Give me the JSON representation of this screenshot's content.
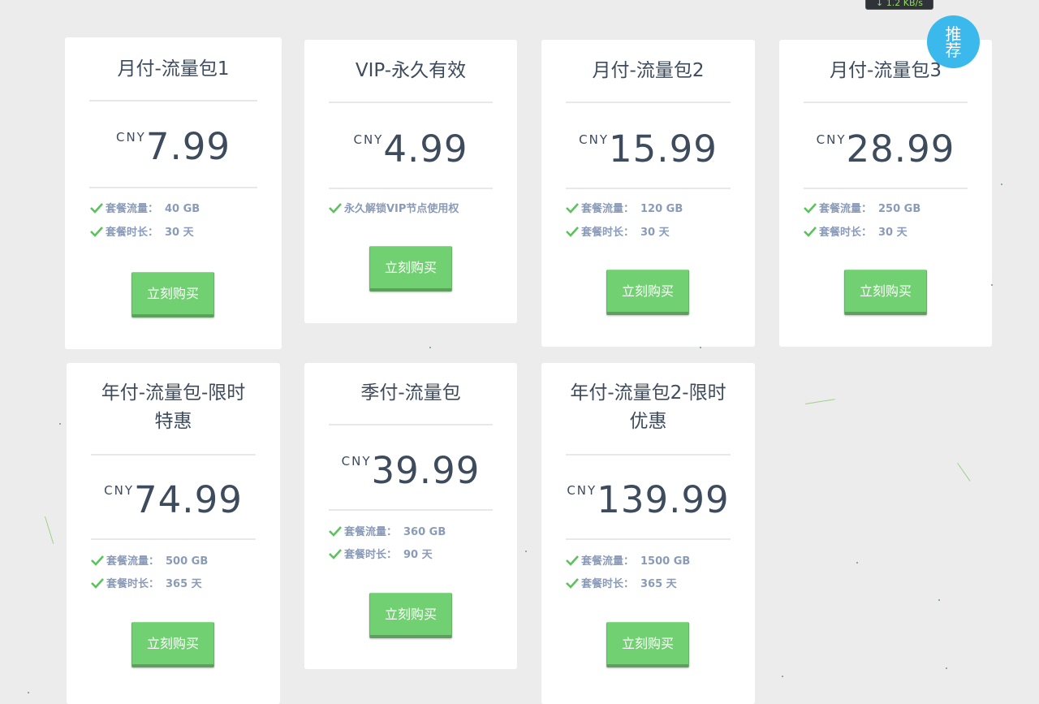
{
  "speed_indicator": "↓ 1.2 KB/s",
  "badge": {
    "line1": "推",
    "line2": "荐"
  },
  "buy_label": "立刻购买",
  "currency": "CNY",
  "plans": [
    {
      "title": "月付-流量包1",
      "price": "7.99",
      "features": [
        {
          "label": "套餐流量：",
          "value": "40 GB"
        },
        {
          "label": "套餐时长：",
          "value": "30 天"
        }
      ]
    },
    {
      "title": "VIP-永久有效",
      "price": "4.99",
      "features": [
        {
          "label": "永久解锁VIP节点使用权",
          "value": ""
        }
      ]
    },
    {
      "title": "月付-流量包2",
      "price": "15.99",
      "features": [
        {
          "label": "套餐流量：",
          "value": "120 GB"
        },
        {
          "label": "套餐时长：",
          "value": "30 天"
        }
      ]
    },
    {
      "title": "月付-流量包3",
      "price": "28.99",
      "features": [
        {
          "label": "套餐流量：",
          "value": "250 GB"
        },
        {
          "label": "套餐时长：",
          "value": "30 天"
        }
      ]
    },
    {
      "title": "年付-流量包-限时特惠",
      "title_line1": "年付-流量包-限时",
      "title_line2": "特惠",
      "price": "74.99",
      "features": [
        {
          "label": "套餐流量：",
          "value": "500 GB"
        },
        {
          "label": "套餐时长：",
          "value": "365 天"
        }
      ]
    },
    {
      "title": "季付-流量包",
      "price": "39.99",
      "features": [
        {
          "label": "套餐流量：",
          "value": "360 GB"
        },
        {
          "label": "套餐时长：",
          "value": "90 天"
        }
      ]
    },
    {
      "title": "年付-流量包2-限时优惠",
      "title_line1": "年付-流量包2-限时",
      "title_line2": "优惠",
      "price": "139.99",
      "features": [
        {
          "label": "套餐流量：",
          "value": "1500 GB"
        },
        {
          "label": "套餐时长：",
          "value": "365 天"
        }
      ]
    }
  ],
  "colors": {
    "background": "#ececec",
    "button": "#71d071",
    "check": "#5cc35c",
    "badge": "#3bb9ec",
    "feature_text": "#8a9bb8",
    "title_text": "#3d4b5c"
  },
  "icons": {
    "check": "checkmark-icon"
  }
}
